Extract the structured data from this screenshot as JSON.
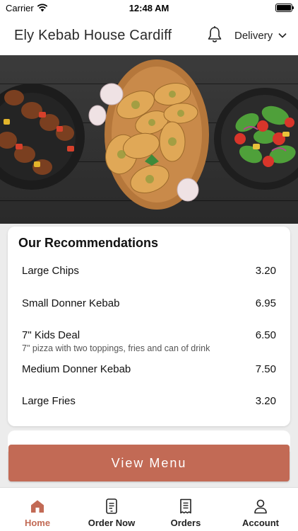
{
  "status_bar": {
    "carrier": "Carrier",
    "time": "12:48 AM"
  },
  "header": {
    "title": "Ely Kebab House Cardiff",
    "delivery_label": "Delivery"
  },
  "recommendations": {
    "title": "Our Recommendations",
    "items": [
      {
        "name": "Large Chips",
        "price": "3.20",
        "description": ""
      },
      {
        "name": "Small Donner Kebab",
        "price": "6.95",
        "description": ""
      },
      {
        "name": "7\" Kids Deal",
        "price": "6.50",
        "description": "7\" pizza with two toppings, fries and can of drink"
      },
      {
        "name": "Medium Donner Kebab",
        "price": "7.50",
        "description": ""
      },
      {
        "name": "Large Fries",
        "price": "3.20",
        "description": ""
      }
    ]
  },
  "view_menu_label": "View Menu",
  "tabs": [
    {
      "label": "Home",
      "icon": "home-icon",
      "active": true
    },
    {
      "label": "Order Now",
      "icon": "order-phone-icon",
      "active": false
    },
    {
      "label": "Orders",
      "icon": "receipt-icon",
      "active": false
    },
    {
      "label": "Account",
      "icon": "person-icon",
      "active": false
    }
  ],
  "colors": {
    "accent": "#c26a55",
    "tab_active": "#c26a55"
  }
}
